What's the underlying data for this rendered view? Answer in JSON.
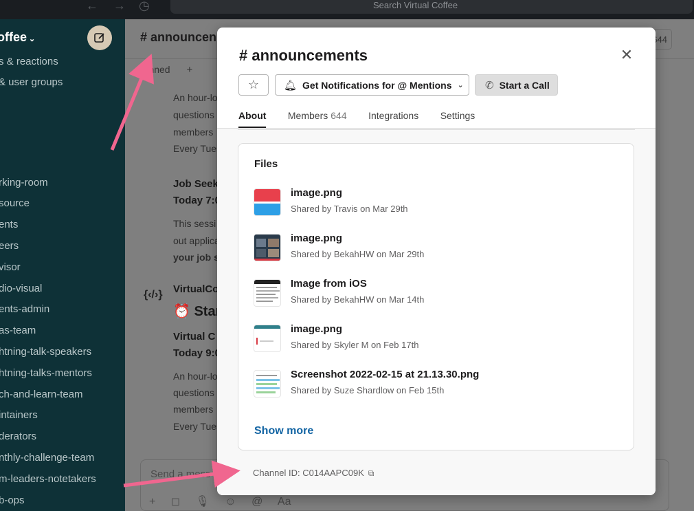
{
  "topbar": {
    "search_placeholder": "Search Virtual Coffee"
  },
  "sidebar": {
    "workspace_name": "offee",
    "items": [
      "s & reactions",
      "& user groups",
      "rking-room",
      "source",
      "ents",
      "eers",
      "visor",
      "dio-visual",
      "ents-admin",
      "as-team",
      "htning-talk-speakers",
      "htning-talks-mentors",
      "ch-and-learn-team",
      "intainers",
      "derators",
      "nthly-challenge-team",
      "m-leaders-notetakers",
      "b-ops"
    ]
  },
  "main": {
    "channel_title": "# announcen",
    "pinned_label": "Pinned",
    "add_bookmark": "+",
    "member_count": "644",
    "lines": [
      "An hour-lo",
      "questions",
      "members",
      "Every Tues",
      "Job Seek",
      "Today 7:0",
      "This sessi",
      "out applica",
      "your job s",
      "VirtualCo",
      "Star",
      "Virtual C",
      "Today 9:0",
      "An hour-lo",
      "questions",
      "members",
      "Every Tues"
    ],
    "composer_placeholder": "Send a mess",
    "composer_tools": [
      "+",
      "◻",
      "🎙",
      "☺",
      "@",
      "Aa"
    ]
  },
  "modal": {
    "title": "# announcements",
    "notifications_button": "Get Notifications for @ Mentions",
    "call_button": "Start a Call",
    "tabs": [
      {
        "label": "About",
        "count": ""
      },
      {
        "label": "Members",
        "count": "644"
      },
      {
        "label": "Integrations",
        "count": ""
      },
      {
        "label": "Settings",
        "count": ""
      }
    ],
    "files_heading": "Files",
    "files": [
      {
        "name": "image.png",
        "meta": "Shared by Travis on Mar 29th"
      },
      {
        "name": "image.png",
        "meta": "Shared by BekahHW on Mar 29th"
      },
      {
        "name": "Image from iOS",
        "meta": "Shared by BekahHW on Mar 14th"
      },
      {
        "name": "image.png",
        "meta": "Shared by Skyler M on Feb 17th"
      },
      {
        "name": "Screenshot 2022-02-15 at 21.13.30.png",
        "meta": "Shared by Suze Shardlow on Feb 15th"
      }
    ],
    "show_more": "Show more",
    "channel_id": "Channel ID: C014AAPC09K"
  },
  "colors": {
    "sidebar_bg": "#0e3137",
    "link": "#1264a3",
    "annotation_arrow": "#f0668f"
  }
}
